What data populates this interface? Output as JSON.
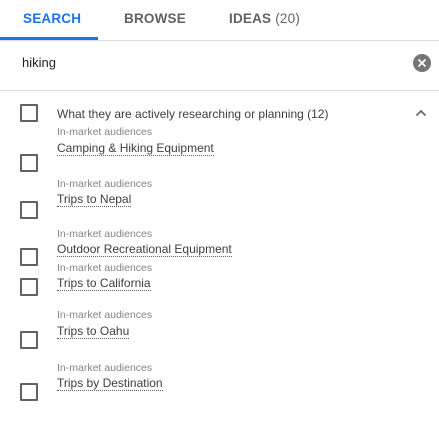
{
  "tabs": [
    {
      "label": "SEARCH"
    },
    {
      "label": "BROWSE"
    },
    {
      "label": "IDEAS",
      "count": "(20)"
    }
  ],
  "search": {
    "value": "hiking"
  },
  "section": {
    "title": "What they are actively researching or planning (12)"
  },
  "items": [
    {
      "category": "In-market audiences",
      "label": "Camping & Hiking Equipment"
    },
    {
      "category": "In-market audiences",
      "label": "Trips to Nepal"
    },
    {
      "category": "In-market audiences",
      "label": "Outdoor Recreational Equipment"
    },
    {
      "category": "In-market audiences",
      "label": "Trips to California"
    },
    {
      "category": "In-market audiences",
      "label": "Trips to Oahu"
    },
    {
      "category": "In-market audiences",
      "label": "Trips by Destination"
    }
  ],
  "colors": {
    "accent": "#1a73e8",
    "text": "#3c4043",
    "muted": "#80868b",
    "icon": "#757575"
  },
  "icons": {
    "clear": "close-circle-icon",
    "collapse": "chevron-up-icon"
  }
}
